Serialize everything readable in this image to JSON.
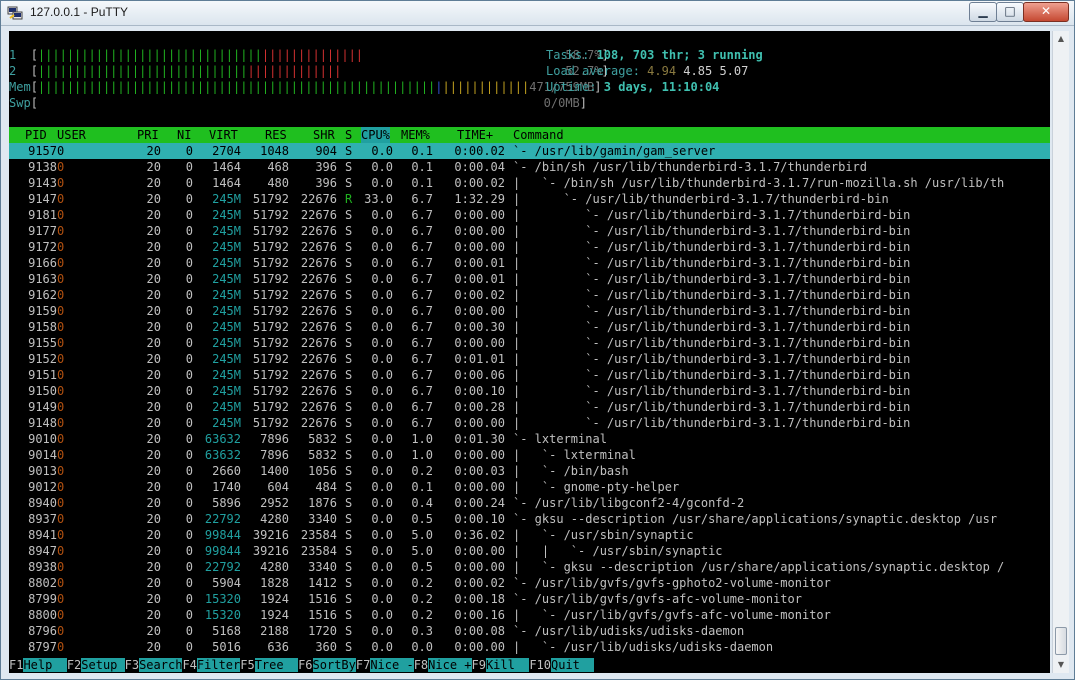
{
  "window": {
    "title": "127.0.0.1 - PuTTY"
  },
  "meters": {
    "cpu1": {
      "label": "1",
      "value": "58.7%"
    },
    "cpu2": {
      "label": "2",
      "value": "52.7%"
    },
    "mem": {
      "label": "Mem",
      "value": "471/759MB"
    },
    "swp": {
      "label": "Swp",
      "value": "0/0MB"
    }
  },
  "info": {
    "tasks_label": "Tasks: ",
    "tasks_value": "108, 703 thr; 3 running",
    "load_label": "Load average: ",
    "load_1": "4.94",
    "load_5": "4.85",
    "load_15": "5.07",
    "uptime_label": "Uptime: ",
    "uptime_value": "3 days, 11:10:04"
  },
  "columns": {
    "pid": "PID",
    "user": "USER",
    "pri": "PRI",
    "ni": "NI",
    "virt": "VIRT",
    "res": "RES",
    "shr": "SHR",
    "s": "S",
    "cpu": "CPU%",
    "mem": "MEM%",
    "time": "TIME+",
    "command": "Command"
  },
  "processes": [
    {
      "pid": "9157",
      "user": "0",
      "pri": "20",
      "ni": "0",
      "virt": "2704",
      "res": "1048",
      "shr": "904",
      "s": "S",
      "cpu": "0.0",
      "mem": "0.1",
      "time": "0:00.02",
      "command": "`- /usr/lib/gamin/gam_server"
    },
    {
      "pid": "9138",
      "user": "0",
      "pri": "20",
      "ni": "0",
      "virt": "1464",
      "res": "468",
      "shr": "396",
      "s": "S",
      "cpu": "0.0",
      "mem": "0.1",
      "time": "0:00.04",
      "command": "`- /bin/sh /usr/lib/thunderbird-3.1.7/thunderbird"
    },
    {
      "pid": "9143",
      "user": "0",
      "pri": "20",
      "ni": "0",
      "virt": "1464",
      "res": "480",
      "shr": "396",
      "s": "S",
      "cpu": "0.0",
      "mem": "0.1",
      "time": "0:00.02",
      "command": "|   `- /bin/sh /usr/lib/thunderbird-3.1.7/run-mozilla.sh /usr/lib/th"
    },
    {
      "pid": "9147",
      "user": "0",
      "pri": "20",
      "ni": "0",
      "virt": "245M",
      "res": "51792",
      "shr": "22676",
      "s": "R",
      "cpu": "33.0",
      "mem": "6.7",
      "time": "1:32.29",
      "command": "|      `- /usr/lib/thunderbird-3.1.7/thunderbird-bin"
    },
    {
      "pid": "9181",
      "user": "0",
      "pri": "20",
      "ni": "0",
      "virt": "245M",
      "res": "51792",
      "shr": "22676",
      "s": "S",
      "cpu": "0.0",
      "mem": "6.7",
      "time": "0:00.00",
      "command": "|         `- /usr/lib/thunderbird-3.1.7/thunderbird-bin"
    },
    {
      "pid": "9177",
      "user": "0",
      "pri": "20",
      "ni": "0",
      "virt": "245M",
      "res": "51792",
      "shr": "22676",
      "s": "S",
      "cpu": "0.0",
      "mem": "6.7",
      "time": "0:00.00",
      "command": "|         `- /usr/lib/thunderbird-3.1.7/thunderbird-bin"
    },
    {
      "pid": "9172",
      "user": "0",
      "pri": "20",
      "ni": "0",
      "virt": "245M",
      "res": "51792",
      "shr": "22676",
      "s": "S",
      "cpu": "0.0",
      "mem": "6.7",
      "time": "0:00.00",
      "command": "|         `- /usr/lib/thunderbird-3.1.7/thunderbird-bin"
    },
    {
      "pid": "9166",
      "user": "0",
      "pri": "20",
      "ni": "0",
      "virt": "245M",
      "res": "51792",
      "shr": "22676",
      "s": "S",
      "cpu": "0.0",
      "mem": "6.7",
      "time": "0:00.01",
      "command": "|         `- /usr/lib/thunderbird-3.1.7/thunderbird-bin"
    },
    {
      "pid": "9163",
      "user": "0",
      "pri": "20",
      "ni": "0",
      "virt": "245M",
      "res": "51792",
      "shr": "22676",
      "s": "S",
      "cpu": "0.0",
      "mem": "6.7",
      "time": "0:00.01",
      "command": "|         `- /usr/lib/thunderbird-3.1.7/thunderbird-bin"
    },
    {
      "pid": "9162",
      "user": "0",
      "pri": "20",
      "ni": "0",
      "virt": "245M",
      "res": "51792",
      "shr": "22676",
      "s": "S",
      "cpu": "0.0",
      "mem": "6.7",
      "time": "0:00.02",
      "command": "|         `- /usr/lib/thunderbird-3.1.7/thunderbird-bin"
    },
    {
      "pid": "9159",
      "user": "0",
      "pri": "20",
      "ni": "0",
      "virt": "245M",
      "res": "51792",
      "shr": "22676",
      "s": "S",
      "cpu": "0.0",
      "mem": "6.7",
      "time": "0:00.00",
      "command": "|         `- /usr/lib/thunderbird-3.1.7/thunderbird-bin"
    },
    {
      "pid": "9158",
      "user": "0",
      "pri": "20",
      "ni": "0",
      "virt": "245M",
      "res": "51792",
      "shr": "22676",
      "s": "S",
      "cpu": "0.0",
      "mem": "6.7",
      "time": "0:00.30",
      "command": "|         `- /usr/lib/thunderbird-3.1.7/thunderbird-bin"
    },
    {
      "pid": "9155",
      "user": "0",
      "pri": "20",
      "ni": "0",
      "virt": "245M",
      "res": "51792",
      "shr": "22676",
      "s": "S",
      "cpu": "0.0",
      "mem": "6.7",
      "time": "0:00.00",
      "command": "|         `- /usr/lib/thunderbird-3.1.7/thunderbird-bin"
    },
    {
      "pid": "9152",
      "user": "0",
      "pri": "20",
      "ni": "0",
      "virt": "245M",
      "res": "51792",
      "shr": "22676",
      "s": "S",
      "cpu": "0.0",
      "mem": "6.7",
      "time": "0:01.01",
      "command": "|         `- /usr/lib/thunderbird-3.1.7/thunderbird-bin"
    },
    {
      "pid": "9151",
      "user": "0",
      "pri": "20",
      "ni": "0",
      "virt": "245M",
      "res": "51792",
      "shr": "22676",
      "s": "S",
      "cpu": "0.0",
      "mem": "6.7",
      "time": "0:00.06",
      "command": "|         `- /usr/lib/thunderbird-3.1.7/thunderbird-bin"
    },
    {
      "pid": "9150",
      "user": "0",
      "pri": "20",
      "ni": "0",
      "virt": "245M",
      "res": "51792",
      "shr": "22676",
      "s": "S",
      "cpu": "0.0",
      "mem": "6.7",
      "time": "0:00.10",
      "command": "|         `- /usr/lib/thunderbird-3.1.7/thunderbird-bin"
    },
    {
      "pid": "9149",
      "user": "0",
      "pri": "20",
      "ni": "0",
      "virt": "245M",
      "res": "51792",
      "shr": "22676",
      "s": "S",
      "cpu": "0.0",
      "mem": "6.7",
      "time": "0:00.28",
      "command": "|         `- /usr/lib/thunderbird-3.1.7/thunderbird-bin"
    },
    {
      "pid": "9148",
      "user": "0",
      "pri": "20",
      "ni": "0",
      "virt": "245M",
      "res": "51792",
      "shr": "22676",
      "s": "S",
      "cpu": "0.0",
      "mem": "6.7",
      "time": "0:00.00",
      "command": "|         `- /usr/lib/thunderbird-3.1.7/thunderbird-bin"
    },
    {
      "pid": "9010",
      "user": "0",
      "pri": "20",
      "ni": "0",
      "virt": "63632",
      "res": "7896",
      "shr": "5832",
      "s": "S",
      "cpu": "0.0",
      "mem": "1.0",
      "time": "0:01.30",
      "command": "`- lxterminal"
    },
    {
      "pid": "9014",
      "user": "0",
      "pri": "20",
      "ni": "0",
      "virt": "63632",
      "res": "7896",
      "shr": "5832",
      "s": "S",
      "cpu": "0.0",
      "mem": "1.0",
      "time": "0:00.00",
      "command": "|   `- lxterminal"
    },
    {
      "pid": "9013",
      "user": "0",
      "pri": "20",
      "ni": "0",
      "virt": "2660",
      "res": "1400",
      "shr": "1056",
      "s": "S",
      "cpu": "0.0",
      "mem": "0.2",
      "time": "0:00.03",
      "command": "|   `- /bin/bash"
    },
    {
      "pid": "9012",
      "user": "0",
      "pri": "20",
      "ni": "0",
      "virt": "1740",
      "res": "604",
      "shr": "484",
      "s": "S",
      "cpu": "0.0",
      "mem": "0.1",
      "time": "0:00.00",
      "command": "|   `- gnome-pty-helper"
    },
    {
      "pid": "8940",
      "user": "0",
      "pri": "20",
      "ni": "0",
      "virt": "5896",
      "res": "2952",
      "shr": "1876",
      "s": "S",
      "cpu": "0.0",
      "mem": "0.4",
      "time": "0:00.24",
      "command": "`- /usr/lib/libgconf2-4/gconfd-2"
    },
    {
      "pid": "8937",
      "user": "0",
      "pri": "20",
      "ni": "0",
      "virt": "22792",
      "res": "4280",
      "shr": "3340",
      "s": "S",
      "cpu": "0.0",
      "mem": "0.5",
      "time": "0:00.10",
      "command": "`- gksu --description /usr/share/applications/synaptic.desktop /usr"
    },
    {
      "pid": "8941",
      "user": "0",
      "pri": "20",
      "ni": "0",
      "virt": "99844",
      "res": "39216",
      "shr": "23584",
      "s": "S",
      "cpu": "0.0",
      "mem": "5.0",
      "time": "0:36.02",
      "command": "|   `- /usr/sbin/synaptic"
    },
    {
      "pid": "8947",
      "user": "0",
      "pri": "20",
      "ni": "0",
      "virt": "99844",
      "res": "39216",
      "shr": "23584",
      "s": "S",
      "cpu": "0.0",
      "mem": "5.0",
      "time": "0:00.00",
      "command": "|   |   `- /usr/sbin/synaptic"
    },
    {
      "pid": "8938",
      "user": "0",
      "pri": "20",
      "ni": "0",
      "virt": "22792",
      "res": "4280",
      "shr": "3340",
      "s": "S",
      "cpu": "0.0",
      "mem": "0.5",
      "time": "0:00.00",
      "command": "|   `- gksu --description /usr/share/applications/synaptic.desktop /"
    },
    {
      "pid": "8802",
      "user": "0",
      "pri": "20",
      "ni": "0",
      "virt": "5904",
      "res": "1828",
      "shr": "1412",
      "s": "S",
      "cpu": "0.0",
      "mem": "0.2",
      "time": "0:00.02",
      "command": "`- /usr/lib/gvfs/gvfs-gphoto2-volume-monitor"
    },
    {
      "pid": "8799",
      "user": "0",
      "pri": "20",
      "ni": "0",
      "virt": "15320",
      "res": "1924",
      "shr": "1516",
      "s": "S",
      "cpu": "0.0",
      "mem": "0.2",
      "time": "0:00.18",
      "command": "`- /usr/lib/gvfs/gvfs-afc-volume-monitor"
    },
    {
      "pid": "8800",
      "user": "0",
      "pri": "20",
      "ni": "0",
      "virt": "15320",
      "res": "1924",
      "shr": "1516",
      "s": "S",
      "cpu": "0.0",
      "mem": "0.2",
      "time": "0:00.16",
      "command": "|   `- /usr/lib/gvfs/gvfs-afc-volume-monitor"
    },
    {
      "pid": "8796",
      "user": "0",
      "pri": "20",
      "ni": "0",
      "virt": "5168",
      "res": "2188",
      "shr": "1720",
      "s": "S",
      "cpu": "0.0",
      "mem": "0.3",
      "time": "0:00.08",
      "command": "`- /usr/lib/udisks/udisks-daemon"
    },
    {
      "pid": "8797",
      "user": "0",
      "pri": "20",
      "ni": "0",
      "virt": "5016",
      "res": "636",
      "shr": "360",
      "s": "S",
      "cpu": "0.0",
      "mem": "0.0",
      "time": "0:00.00",
      "command": "|   `- /usr/lib/udisks/udisks-daemon"
    }
  ],
  "function_keys": [
    {
      "key": "F1",
      "label": "Help  "
    },
    {
      "key": "F2",
      "label": "Setup "
    },
    {
      "key": "F3",
      "label": "Search"
    },
    {
      "key": "F4",
      "label": "Filter"
    },
    {
      "key": "F5",
      "label": "Tree  "
    },
    {
      "key": "F6",
      "label": "SortBy"
    },
    {
      "key": "F7",
      "label": "Nice -"
    },
    {
      "key": "F8",
      "label": "Nice +"
    },
    {
      "key": "F9",
      "label": "Kill  "
    },
    {
      "key": "F10",
      "label": "Quit  "
    }
  ],
  "colors": {
    "header_bg": "#1fbf1f",
    "selected_bg": "#2fb0b0",
    "function_label_bg": "#20a0a0",
    "user_text": "#b05010"
  },
  "icons": {
    "app": "putty-icon",
    "minimize": "minimize-icon",
    "maximize": "maximize-icon",
    "close": "close-icon"
  }
}
